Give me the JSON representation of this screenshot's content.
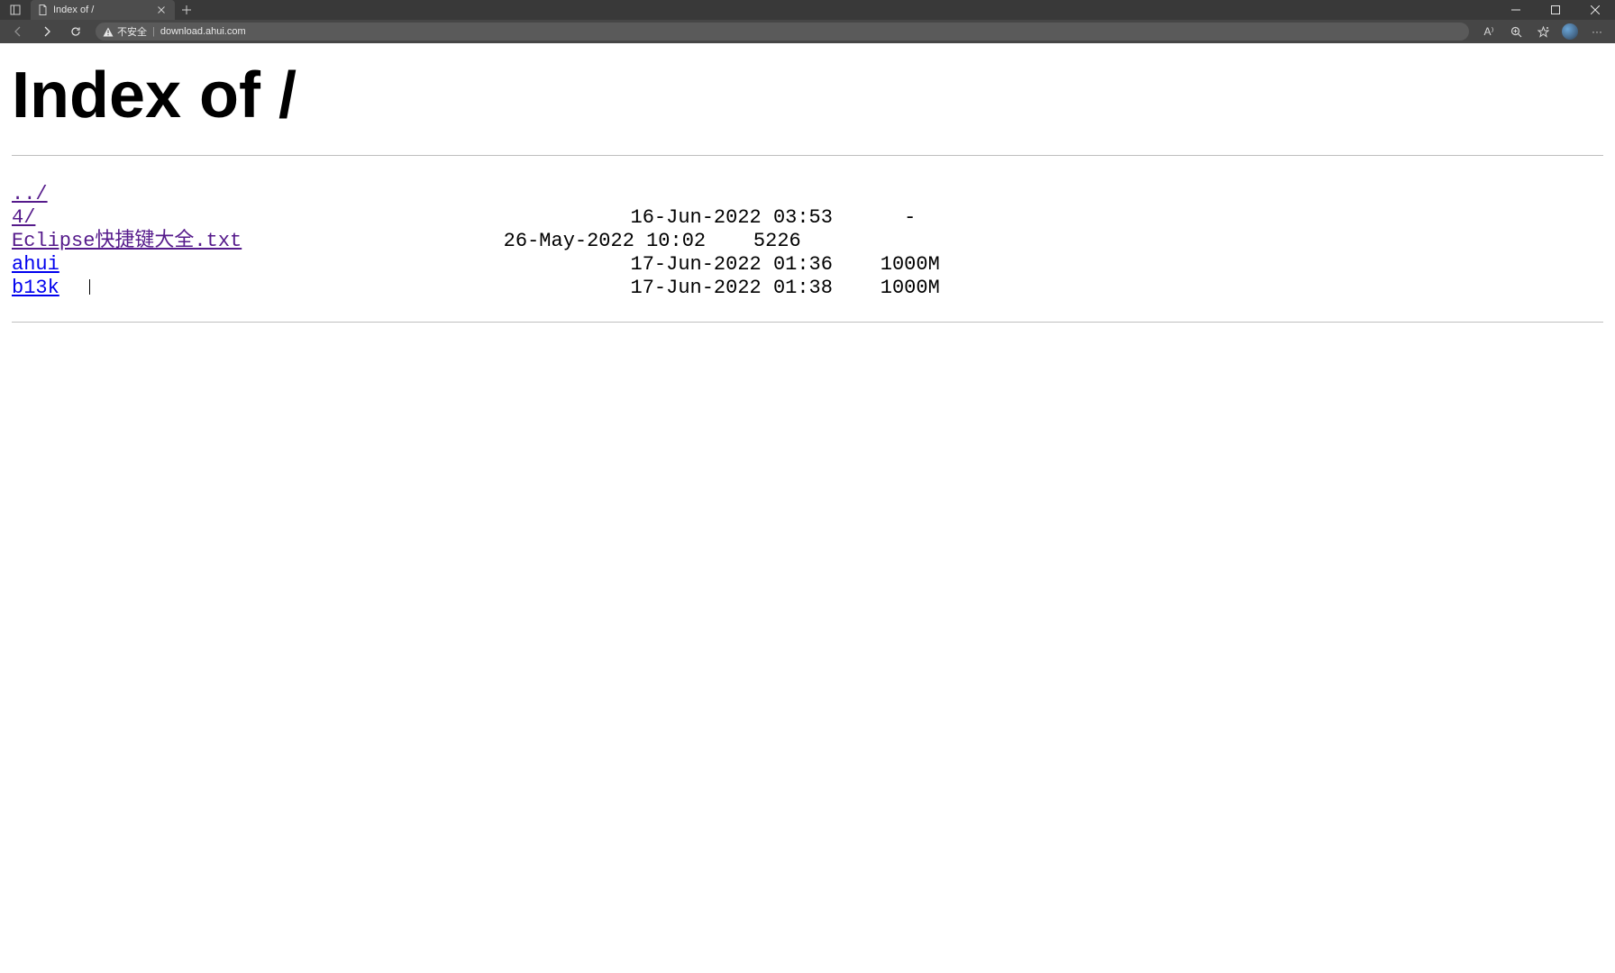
{
  "browser": {
    "tab_title": "Index of /",
    "new_tab_tooltip": "New tab"
  },
  "address_bar": {
    "security_label": "不安全",
    "url": "download.ahui.com"
  },
  "toolbar_icons": {
    "read_aloud_label": "A⁾",
    "more_label": "···"
  },
  "page": {
    "heading": "Index of /",
    "parent_link": "../",
    "entries": [
      {
        "name": "4/",
        "name_width": 2,
        "date": "16-Jun-2022 03:53",
        "size": "-",
        "visited": true,
        "date_col": 52,
        "size_col_width": 7
      },
      {
        "name": "Eclipse快捷键大全.txt",
        "name_width": 25,
        "date": "26-May-2022 10:02",
        "size": "5226",
        "visited": true,
        "date_col": 47,
        "size_col_width": 8
      },
      {
        "name": "ahui",
        "name_width": 4,
        "date": "17-Jun-2022 01:36",
        "size": "1000M",
        "visited": false,
        "date_col": 52,
        "size_col_width": 9
      },
      {
        "name": "b13k",
        "name_width": 4,
        "date": "17-Jun-2022 01:38",
        "size": "1000M",
        "visited": false,
        "date_col": 52,
        "size_col_width": 9
      }
    ]
  }
}
